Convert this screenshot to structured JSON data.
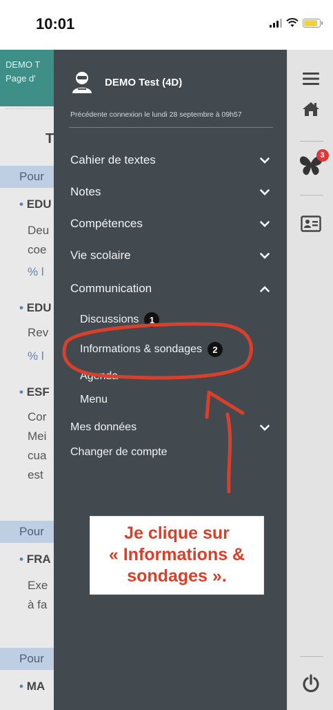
{
  "status_bar": {
    "time": "10:01"
  },
  "background_page": {
    "header_line1": "DEMO T",
    "header_line2": "Page d'",
    "title_letter": "T",
    "section_1": "Pour",
    "item_1": "EDU",
    "item_1_line1": "Deu",
    "item_1_line2": "coe",
    "item_1_link": "% l",
    "item_2": "EDU",
    "item_2_line1": "Rev",
    "item_2_link": "% l",
    "item_3": "ESF",
    "item_3_line1": "Cor",
    "item_3_line2": "Mei",
    "item_3_line3": "cua",
    "item_3_line4": "est",
    "section_2": "Pour",
    "item_4": "FRA",
    "item_4_line1": "Exe",
    "item_4_line2": "à fa",
    "section_3": "Pour",
    "item_5": "MA"
  },
  "drawer": {
    "profile_name": "DEMO Test (4D)",
    "last_login": "Précédente connexion le lundi 28 septembre à 09h57",
    "menu": [
      {
        "label": "Cahier de textes",
        "icon": "chevron-down-icon"
      },
      {
        "label": "Notes",
        "icon": "chevron-down-icon"
      },
      {
        "label": "Compétences",
        "icon": "chevron-down-icon"
      },
      {
        "label": "Vie scolaire",
        "icon": "chevron-down-icon"
      },
      {
        "label": "Communication",
        "icon": "chevron-up-icon"
      }
    ],
    "communication_sub": [
      {
        "label": "Discussions",
        "badge": "1"
      },
      {
        "label": "Informations & sondages",
        "badge": "2"
      },
      {
        "label": "Agenda"
      },
      {
        "label": "Menu"
      }
    ],
    "mes_donnees": "Mes données",
    "changer_compte": "Changer de compte"
  },
  "rail": {
    "notification_count": "3",
    "icons": [
      "hamburger-icon",
      "home-icon",
      "butterfly-icon",
      "id-card-icon",
      "power-icon"
    ]
  },
  "annotation": {
    "line1": "Je clique sur",
    "line2": "« Informations &",
    "line3": "sondages ».",
    "color": "#d9402b"
  }
}
